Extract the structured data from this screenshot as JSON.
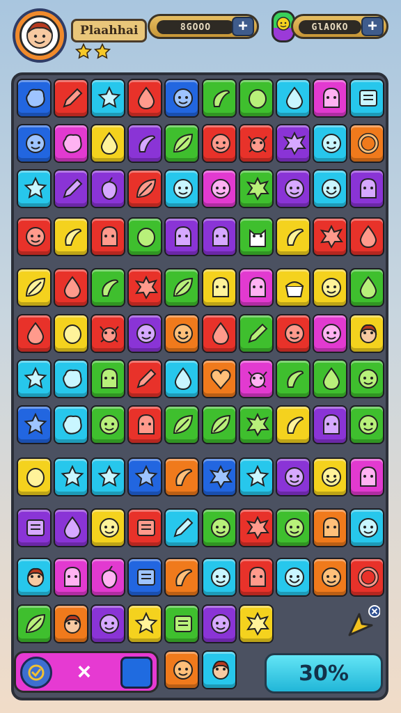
{
  "header": {
    "player_name": "Plaahhai",
    "stars": 2,
    "currency_1": "8GOOO",
    "currency_2": "GlAOKO",
    "add_icon": "plus-icon"
  },
  "colors": {
    "blue": "#2266e0",
    "red": "#e8322a",
    "cyan": "#27c7ec",
    "green": "#3fbf2e",
    "yellow": "#f4d21e",
    "orange": "#f07a1c",
    "purple": "#8a34d6",
    "magenta": "#e23ad0"
  },
  "board": {
    "tiles": [
      [
        "blue:blob",
        "red:pencil",
        "cyan:star",
        "red:drop",
        "blue:face",
        "green:chili",
        "green:lemon",
        "cyan:drop",
        "magenta:ghost",
        "cyan:card"
      ],
      [
        "blue:face",
        "magenta:blob",
        "yellow:drop",
        "purple:chili",
        "green:leaf",
        "red:face",
        "red:crab",
        "purple:splat",
        "cyan:face",
        "orange:ring"
      ],
      [
        "cyan:star",
        "purple:pencil",
        "purple:berry",
        "red:leaf",
        "cyan:face",
        "magenta:face",
        "green:splat",
        "purple:face",
        "cyan:smile",
        "purple:ghost"
      ],
      [
        "red:face",
        "yellow:chili",
        "red:ghost",
        "green:lemon",
        "purple:ghost",
        "purple:ghost",
        "green:cat",
        "yellow:chili",
        "red:splat",
        "red:drop"
      ],
      [
        "yellow:leaf",
        "red:drop",
        "green:chili",
        "red:splat",
        "green:leaf",
        "yellow:ghost",
        "magenta:ghost",
        "yellow:cake",
        "yellow:face",
        "green:drop"
      ],
      [
        "red:drop",
        "yellow:lemon",
        "red:crab",
        "purple:face",
        "orange:smile",
        "red:drop",
        "green:pencil",
        "red:face",
        "magenta:face",
        "yellow:person"
      ],
      [
        "cyan:star",
        "cyan:blob",
        "green:ghost",
        "red:pencil",
        "cyan:drop",
        "orange:heart",
        "magenta:crab",
        "green:chili",
        "green:drop",
        "green:face"
      ],
      [
        "blue:star",
        "cyan:blob",
        "green:face",
        "red:ghost",
        "green:leaf",
        "green:leaf",
        "green:splat",
        "yellow:chili",
        "purple:ghost",
        "green:face"
      ],
      [
        "yellow:lemon",
        "cyan:star",
        "cyan:star",
        "blue:star",
        "orange:chili",
        "blue:splat",
        "cyan:star",
        "purple:face",
        "yellow:smile",
        "magenta:ghost"
      ],
      [
        "purple:card",
        "purple:drop",
        "yellow:face",
        "red:card",
        "cyan:pencil",
        "green:face",
        "red:splat",
        "green:face",
        "orange:ghost",
        "cyan:face"
      ],
      [
        "cyan:person",
        "magenta:ghost",
        "magenta:berry",
        "blue:card",
        "orange:chili",
        "cyan:face",
        "red:ghost",
        "cyan:smile",
        "orange:face",
        "red:ring"
      ],
      [
        "green:leaf",
        "orange:person",
        "purple:face",
        "yellow:star",
        "green:card",
        "purple:face",
        "yellow:splat"
      ],
      [
        "",
        "",
        "",
        "",
        "orange:face",
        "cyan:person"
      ]
    ]
  },
  "footer": {
    "close_label": "×",
    "progress_label": "30%",
    "progress_value": 30
  }
}
